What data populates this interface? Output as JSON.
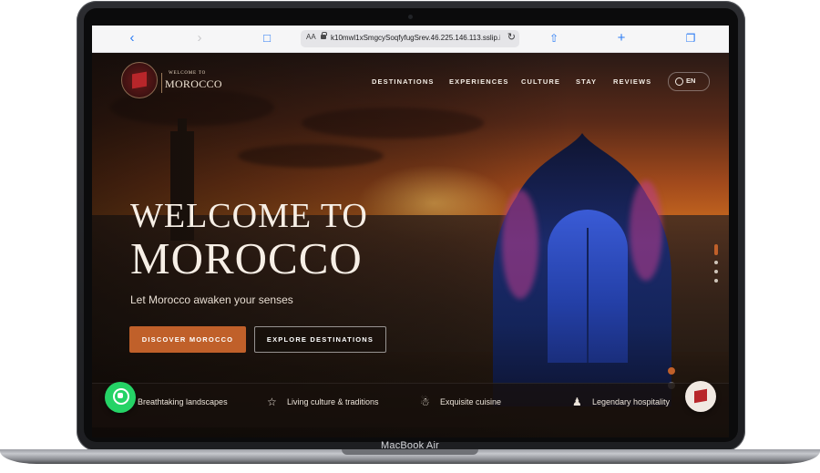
{
  "device": {
    "label": "MacBook Air"
  },
  "browser": {
    "back_icon": "chevron-left-icon",
    "forward_icon": "chevron-right-icon",
    "reader_label": "AA",
    "url": "k10mwl1xSmgcySoqfyfugSrev.46.225.146.113.sslip.io"
  },
  "site": {
    "logo": {
      "top": "WELCOME TO",
      "name": "MOROCCO"
    },
    "nav": [
      "DESTINATIONS",
      "EXPERIENCES",
      "CULTURE",
      "STAY",
      "REVIEWS"
    ],
    "lang": "EN",
    "hero": {
      "title_line1": "WELCOME TO",
      "title_line2": "MOROCCO",
      "tagline": "Let Morocco awaken your senses",
      "primary_cta": "DISCOVER MOROCCO",
      "secondary_cta": "EXPLORE DESTINATIONS"
    },
    "features": [
      {
        "icon": "mountain-icon",
        "label": "Breathtaking landscapes"
      },
      {
        "icon": "star-icon",
        "label": "Living culture & traditions"
      },
      {
        "icon": "cloche-icon",
        "label": "Exquisite cuisine"
      },
      {
        "icon": "people-icon",
        "label": "Legendary hospitality"
      }
    ],
    "slider": {
      "count": 4,
      "active": 1
    },
    "colors": {
      "accent": "#c0602a",
      "whatsapp": "#25d366"
    }
  }
}
